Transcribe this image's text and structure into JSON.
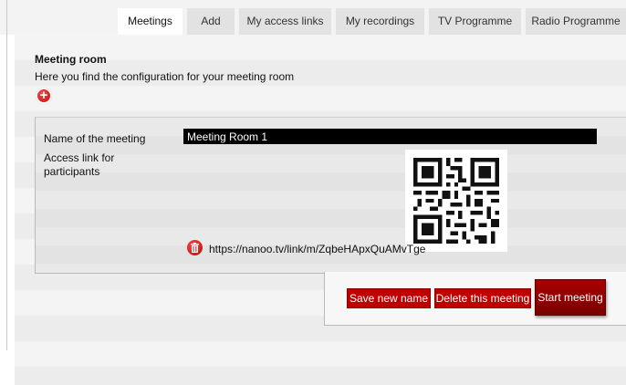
{
  "tabs": [
    {
      "label": "Meetings",
      "active": true
    },
    {
      "label": "Add",
      "active": false
    },
    {
      "label": "My access links",
      "active": false
    },
    {
      "label": "My recordings",
      "active": false
    },
    {
      "label": "TV Programme",
      "active": false
    },
    {
      "label": "Radio Programme",
      "active": false
    }
  ],
  "section": {
    "title": "Meeting room",
    "description": "Here you find the configuration for your meeting room",
    "add_icon": "plus-circle-icon"
  },
  "meeting": {
    "name_label": "Name of the meeting",
    "name_value": "Meeting Room 1",
    "access_label": "Access link for participants",
    "access_url": "https://nanoo.tv/link/m/ZqbeHApxQuAMvTge",
    "qr_icon": "qr-code-icon",
    "delete_icon": "trash-icon"
  },
  "actions": {
    "save": "Save new name",
    "delete": "Delete this meeting",
    "start": "Start meeting"
  },
  "colors": {
    "accent": "#c00000",
    "start_button": "#8e0000",
    "input_bg": "#000000"
  }
}
